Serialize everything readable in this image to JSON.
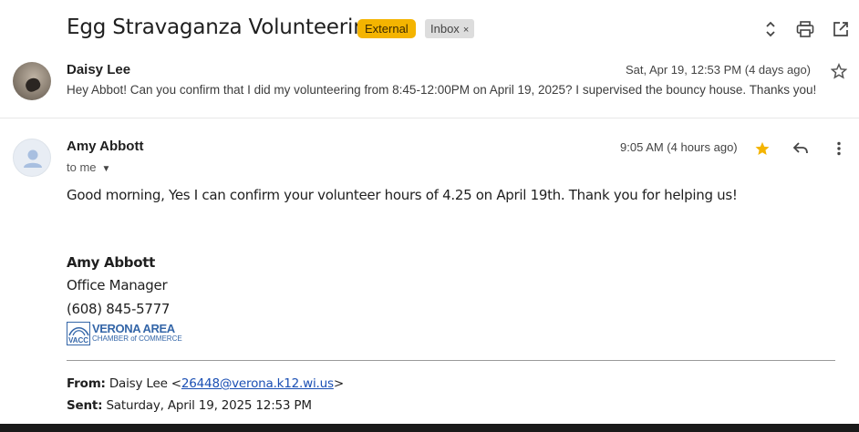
{
  "thread": {
    "subject": "Egg Stravaganza Volunteering",
    "badge_external": "External",
    "badge_inbox": "Inbox",
    "badge_inbox_close": "×"
  },
  "toolbar": {
    "icons": [
      "expand-collapse-icon",
      "print-icon",
      "open-in-new-window-icon"
    ]
  },
  "message1": {
    "sender": "Daisy Lee",
    "date": "Sat, Apr 19, 12:53 PM (4 days ago)",
    "snippet": "Hey Abbot! Can you confirm that I did my volunteering from 8:45-12:00PM on April 19, 2025? I supervised the bouncy house. Thanks you!",
    "starred": false
  },
  "message2": {
    "sender": "Amy Abbott",
    "recipient": "to me",
    "date": "9:05 AM (4 hours ago)",
    "starred": true,
    "star_color": "#f4b400",
    "body": "Good morning, Yes I can confirm your volunteer hours of 4.25 on April 19th. Thank you for helping us!",
    "signature": {
      "name": "Amy Abbott",
      "title": "Office Manager",
      "phone": "(608) 845-5777",
      "logo_text_main": "VERONA AREA",
      "logo_text_sub": "CHAMBER of COMMERCE",
      "logo_mark_text": "VACC"
    },
    "quoted": {
      "from_label": "From:",
      "from_name": "Daisy Lee <",
      "from_email": "26448@verona.k12.wi.us",
      "from_close": ">",
      "sent_label": "Sent:",
      "sent_value": "Saturday, April 19, 2025 12:53 PM"
    }
  },
  "colors": {
    "external_badge": "#f4b400",
    "inbox_badge": "#dddddd",
    "link": "#1a4fb4",
    "logo_blue": "#3466a8"
  }
}
